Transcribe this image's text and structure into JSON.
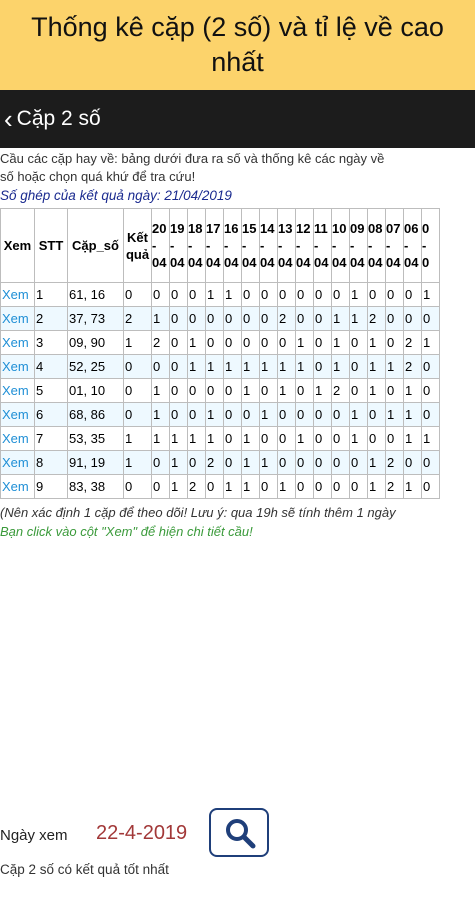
{
  "header": {
    "title": "Thống kê cặp (2 số) và tỉ lệ về cao nhất"
  },
  "nav": {
    "back_icon": "chevron-left-icon",
    "title": "Cặp 2 số"
  },
  "intro": {
    "line1": "Cầu các cặp hay về: bảng dưới đưa ra số và thống kê các ngày về",
    "line2": "số hoặc chọn quá khứ để tra cứu!",
    "date_line": "Số ghép của kết quả ngày: 21/04/2019"
  },
  "table": {
    "headers": {
      "xem": "Xem",
      "stt": "STT",
      "cap": "Cặp_số",
      "ket": "Kết",
      "qua": "quả"
    },
    "date_cols": [
      {
        "day": "20",
        "sep": "-",
        "mon": "04"
      },
      {
        "day": "19",
        "sep": "-",
        "mon": "04"
      },
      {
        "day": "18",
        "sep": "-",
        "mon": "04"
      },
      {
        "day": "17",
        "sep": "-",
        "mon": "04"
      },
      {
        "day": "16",
        "sep": "-",
        "mon": "04"
      },
      {
        "day": "15",
        "sep": "-",
        "mon": "04"
      },
      {
        "day": "14",
        "sep": "-",
        "mon": "04"
      },
      {
        "day": "13",
        "sep": "-",
        "mon": "04"
      },
      {
        "day": "12",
        "sep": "-",
        "mon": "04"
      },
      {
        "day": "11",
        "sep": "-",
        "mon": "04"
      },
      {
        "day": "10",
        "sep": "-",
        "mon": "04"
      },
      {
        "day": "09",
        "sep": "-",
        "mon": "04"
      },
      {
        "day": "08",
        "sep": "-",
        "mon": "04"
      },
      {
        "day": "07",
        "sep": "-",
        "mon": "04"
      },
      {
        "day": "06",
        "sep": "-",
        "mon": "04"
      },
      {
        "day": "0",
        "sep": "-",
        "mon": "0"
      }
    ],
    "rows": [
      {
        "xem": "Xem",
        "stt": "1",
        "pair": "61, 16",
        "kq": "0",
        "vals": [
          "0",
          "0",
          "0",
          "1",
          "1",
          "0",
          "0",
          "0",
          "0",
          "0",
          "0",
          "1",
          "0",
          "0",
          "0",
          "1"
        ]
      },
      {
        "xem": "Xem",
        "stt": "2",
        "pair": "37, 73",
        "kq": "2",
        "vals": [
          "1",
          "0",
          "0",
          "0",
          "0",
          "0",
          "0",
          "2",
          "0",
          "0",
          "1",
          "1",
          "2",
          "0",
          "0",
          "0"
        ]
      },
      {
        "xem": "Xem",
        "stt": "3",
        "pair": "09, 90",
        "kq": "1",
        "vals": [
          "2",
          "0",
          "1",
          "0",
          "0",
          "0",
          "0",
          "0",
          "1",
          "0",
          "1",
          "0",
          "1",
          "0",
          "2",
          "1"
        ]
      },
      {
        "xem": "Xem",
        "stt": "4",
        "pair": "52, 25",
        "kq": "0",
        "vals": [
          "0",
          "0",
          "1",
          "1",
          "1",
          "1",
          "1",
          "1",
          "1",
          "0",
          "1",
          "0",
          "1",
          "1",
          "2",
          "0"
        ]
      },
      {
        "xem": "Xem",
        "stt": "5",
        "pair": "01, 10",
        "kq": "0",
        "vals": [
          "1",
          "0",
          "0",
          "0",
          "0",
          "1",
          "0",
          "1",
          "0",
          "1",
          "2",
          "0",
          "1",
          "0",
          "1",
          "0"
        ]
      },
      {
        "xem": "Xem",
        "stt": "6",
        "pair": "68, 86",
        "kq": "0",
        "vals": [
          "1",
          "0",
          "0",
          "1",
          "0",
          "0",
          "1",
          "0",
          "0",
          "0",
          "0",
          "1",
          "0",
          "1",
          "1",
          "0"
        ]
      },
      {
        "xem": "Xem",
        "stt": "7",
        "pair": "53, 35",
        "kq": "1",
        "vals": [
          "1",
          "1",
          "1",
          "1",
          "0",
          "1",
          "0",
          "0",
          "1",
          "0",
          "0",
          "1",
          "0",
          "0",
          "1",
          "1"
        ]
      },
      {
        "xem": "Xem",
        "stt": "8",
        "pair": "91, 19",
        "kq": "1",
        "vals": [
          "0",
          "1",
          "0",
          "2",
          "0",
          "1",
          "1",
          "0",
          "0",
          "0",
          "0",
          "0",
          "1",
          "2",
          "0",
          "0"
        ]
      },
      {
        "xem": "Xem",
        "stt": "9",
        "pair": "83, 38",
        "kq": "0",
        "vals": [
          "0",
          "1",
          "2",
          "0",
          "1",
          "1",
          "0",
          "1",
          "0",
          "0",
          "0",
          "0",
          "1",
          "2",
          "1",
          "0"
        ]
      }
    ]
  },
  "note": "(Nên xác định 1 cặp để theo dõi! Lưu ý: qua 19h sẽ tính thêm 1 ngày",
  "hint": "Bạn click vào cột \"Xem\" để hiện chi tiết cầu!",
  "bottom": {
    "date_label": "Ngày xem",
    "date_value": "22-4-2019",
    "search_icon": "search-icon",
    "result_label": "Cặp 2 số có kết quả tốt nhất"
  },
  "colors": {
    "header_bg": "#fcd36b",
    "nav_bg": "#1c1c1c",
    "link": "#1f8fd6",
    "date_value": "#a23838",
    "hint": "#3a9a3a"
  }
}
